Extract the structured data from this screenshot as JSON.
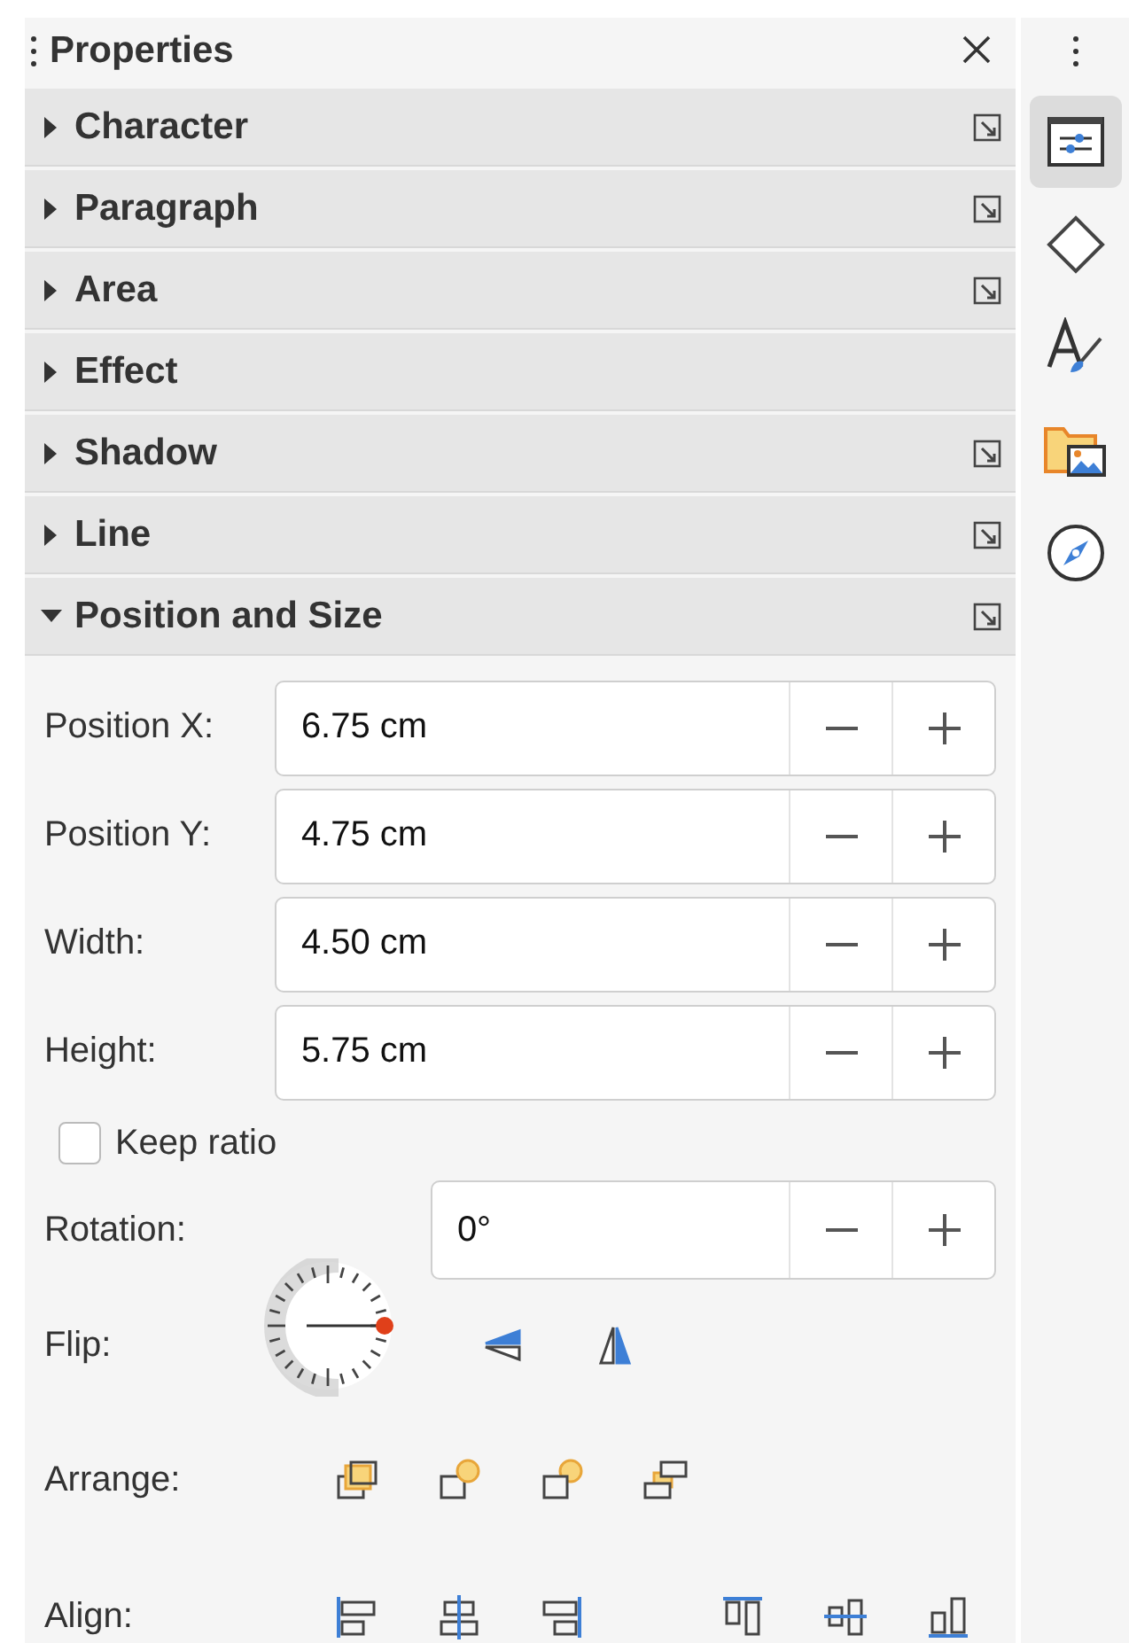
{
  "panel": {
    "title": "Properties"
  },
  "sections": [
    {
      "title": "Character",
      "expanded": false,
      "more_options": true
    },
    {
      "title": "Paragraph",
      "expanded": false,
      "more_options": true
    },
    {
      "title": "Area",
      "expanded": false,
      "more_options": true
    },
    {
      "title": "Effect",
      "expanded": false,
      "more_options": false
    },
    {
      "title": "Shadow",
      "expanded": false,
      "more_options": true
    },
    {
      "title": "Line",
      "expanded": false,
      "more_options": true
    },
    {
      "title": "Position and Size",
      "expanded": true,
      "more_options": true
    }
  ],
  "position_size": {
    "fields": [
      {
        "label": "Position X:",
        "value": "6.75 cm"
      },
      {
        "label": "Position Y:",
        "value": "4.75 cm"
      },
      {
        "label": "Width:",
        "value": "4.50 cm"
      },
      {
        "label": "Height:",
        "value": "5.75 cm"
      }
    ],
    "keep_ratio": {
      "label": "Keep ratio",
      "checked": false
    },
    "rotation": {
      "label": "Rotation:",
      "value": "0°"
    },
    "flip": {
      "label": "Flip:"
    },
    "arrange": {
      "label": "Arrange:"
    },
    "align": {
      "label": "Align:"
    }
  },
  "tab_bar": {
    "tabs": [
      {
        "kind": "properties",
        "selected": true
      },
      {
        "kind": "shapes",
        "selected": false
      },
      {
        "kind": "styles",
        "selected": false
      },
      {
        "kind": "gallery",
        "selected": false
      },
      {
        "kind": "navigator",
        "selected": false
      }
    ]
  }
}
